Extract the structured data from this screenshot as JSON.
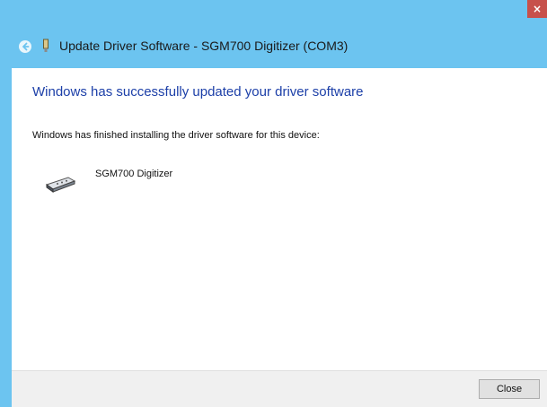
{
  "window": {
    "close_glyph": "×",
    "title": "Update Driver Software - SGM700 Digitizer (COM3)",
    "back_icon": "back-arrow-icon",
    "device_icon": "device-icon"
  },
  "content": {
    "headline": "Windows has successfully updated your driver software",
    "subtext": "Windows has finished installing the driver software for this device:",
    "device_name": "SGM700 Digitizer",
    "device_icon": "serial-port-connector-icon"
  },
  "footer": {
    "close_label": "Close"
  },
  "colors": {
    "chrome": "#6cc4f0",
    "headline": "#1c3fa8",
    "close_x_bg": "#c7504b"
  }
}
